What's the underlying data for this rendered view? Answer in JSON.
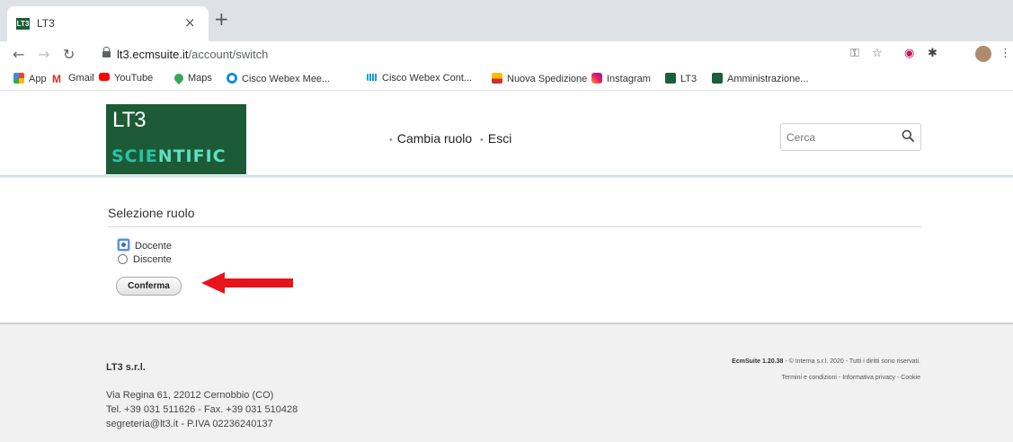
{
  "browser": {
    "tab_favicon": "LT3",
    "tab_title": "LT3",
    "tab_close": "×",
    "new_tab": "+",
    "url_host": "lt3.ecmsuite.it",
    "url_path": "/account/switch",
    "bookmarks": [
      {
        "label": "App",
        "icon": "apps-grid-icon",
        "color": "#ea4335"
      },
      {
        "label": "Gmail",
        "icon": "gmail-icon",
        "color": "#d93025"
      },
      {
        "label": "YouTube",
        "icon": "youtube-icon",
        "color": "#ff0000"
      },
      {
        "label": "Maps",
        "icon": "maps-pin-icon",
        "color": "#34a853"
      },
      {
        "label": "Cisco Webex Mee...",
        "icon": "webex-icon",
        "color": "#1a73e8"
      },
      {
        "label": "Cisco Webex Cont...",
        "icon": "cisco-icon",
        "color": "#049fd9"
      },
      {
        "label": "Nuova Spedizione",
        "icon": "shipping-icon",
        "color": "#fbbc04"
      },
      {
        "label": "Instagram",
        "icon": "instagram-icon",
        "color": "#c13584"
      },
      {
        "label": "LT3",
        "icon": "lt3-icon",
        "color": "#1b5e3a"
      },
      {
        "label": "Amministrazione...",
        "icon": "lt3-icon",
        "color": "#1b5e3a"
      }
    ]
  },
  "header": {
    "logo_top": "LT3",
    "logo_sci": "SCIE",
    "logo_entific": "NTIFIC",
    "nav": [
      {
        "label": "Cambia ruolo"
      },
      {
        "label": "Esci"
      }
    ],
    "search_placeholder": "Cerca"
  },
  "main": {
    "title": "Selezione ruolo",
    "roles": [
      {
        "label": "Docente",
        "checked": true
      },
      {
        "label": "Discente",
        "checked": false
      }
    ],
    "confirm_label": "Conferma"
  },
  "footer": {
    "company": "LT3 s.r.l.",
    "address_line1": "Via Regina 61, 22012 Cernobbio (CO)",
    "address_line2": "Tel. +39 031 511626 - Fax. +39 031 510428",
    "email": "segreteria@lt3.it",
    "vat": "- P.IVA 02236240137",
    "version": "EcmSuite 1.20.38",
    "copyright_prefix": "- ©",
    "interna": "Interna s.r.l.",
    "copyright_suffix": "2020 - Tutti i diritti sono riservati.",
    "links": [
      "Termini e condizioni",
      "Informativa privacy",
      "Cookie"
    ]
  },
  "colors": {
    "brand_green": "#1d5b36",
    "brand_teal": "#27c3a8",
    "arrow_red": "#e8141b"
  }
}
